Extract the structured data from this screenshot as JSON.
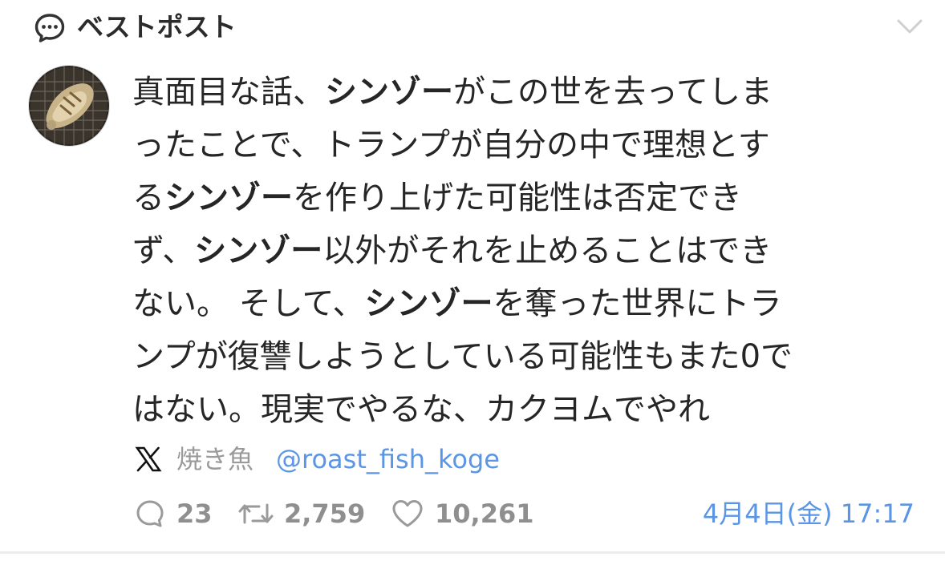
{
  "header": {
    "title": "ベストポスト",
    "icon": "speech-bubble-icon",
    "menu_icon": "chevron-down-icon"
  },
  "post": {
    "lines": [
      {
        "segments": [
          {
            "text": "真面目な話、",
            "bold": false
          },
          {
            "text": "シンゾー",
            "bold": true
          },
          {
            "text": "がこの世を去ってしま",
            "bold": false
          }
        ]
      },
      {
        "segments": [
          {
            "text": "ったことで、トランプが自分の中で理想とす",
            "bold": false
          }
        ]
      },
      {
        "segments": [
          {
            "text": "る",
            "bold": false
          },
          {
            "text": "シンゾー",
            "bold": true
          },
          {
            "text": "を作り上げた可能性は否定でき",
            "bold": false
          }
        ]
      },
      {
        "segments": [
          {
            "text": "ず、",
            "bold": false
          },
          {
            "text": "シンゾー",
            "bold": true
          },
          {
            "text": "以外がそれを止めることはでき",
            "bold": false
          }
        ]
      },
      {
        "segments": [
          {
            "text": "ない。 そして、",
            "bold": false
          },
          {
            "text": "シンゾー",
            "bold": true
          },
          {
            "text": "を奪った世界にトラ",
            "bold": false
          }
        ]
      },
      {
        "segments": [
          {
            "text": "ンプが復讐しようとしている可能性もまた0で",
            "bold": false
          }
        ]
      },
      {
        "segments": [
          {
            "text": "はない。現実でやるな、カクヨムでやれ",
            "bold": false
          }
        ]
      }
    ]
  },
  "author": {
    "platform_icon": "x-logo-icon",
    "name": "焼き魚",
    "handle": "@roast_fish_koge"
  },
  "stats": {
    "replies": "23",
    "reposts": "2,759",
    "likes": "10,261",
    "timestamp": "4月4日(金) 17:17"
  },
  "colors": {
    "link": "#5b95e6",
    "muted": "#8f8f8f",
    "text": "#262626"
  }
}
